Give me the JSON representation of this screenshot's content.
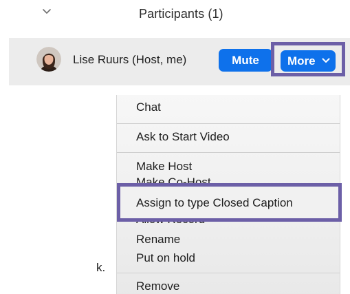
{
  "panel": {
    "title": "Participants (1)",
    "collapse_icon": "chevron-down-icon"
  },
  "participant": {
    "name": "Lise Ruurs  (Host, me)",
    "avatar_icon": "user-avatar",
    "mute_label": "Mute",
    "more_label": "More",
    "more_icon": "chevron-down-icon"
  },
  "menu": {
    "items": {
      "chat": "Chat",
      "ask_video": "Ask to Start Video",
      "make_host": "Make Host",
      "make_cohost": "Make Co-Host",
      "assign_cc": "Assign to type Closed Caption",
      "allow_record": "Allow Record",
      "rename": "Rename",
      "put_on_hold": "Put on hold",
      "remove": "Remove"
    }
  },
  "colors": {
    "accent_blue": "#0e71eb",
    "highlight_purple": "#6c5fa7",
    "row_background": "#ececec"
  },
  "fragment": "k."
}
